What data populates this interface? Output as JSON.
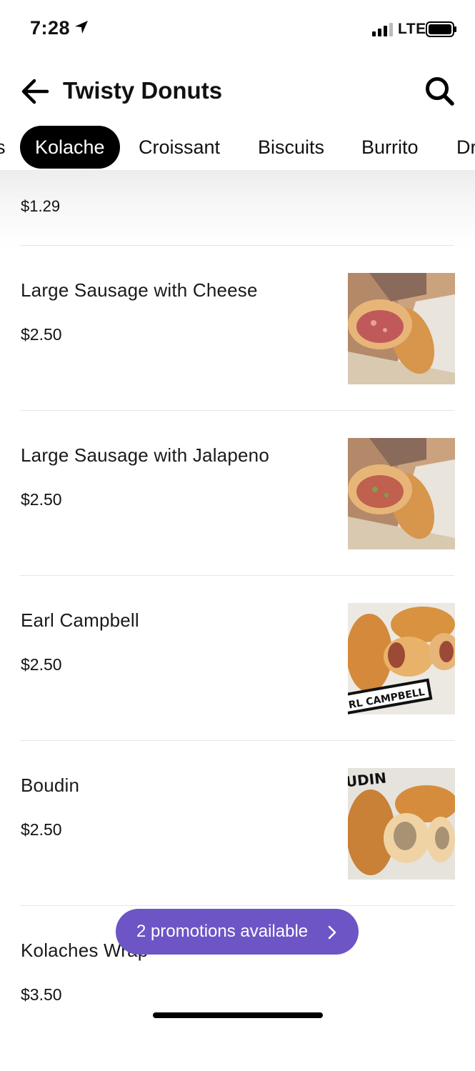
{
  "status_bar": {
    "time": "7:28",
    "network": "LTE",
    "icons": [
      "location-arrow-icon",
      "signal-icon",
      "battery-icon"
    ]
  },
  "header": {
    "title": "Twisty Donuts",
    "back_icon": "back-arrow-icon",
    "search_icon": "search-icon"
  },
  "tabs": [
    {
      "label": "s",
      "active": false
    },
    {
      "label": "Kolache",
      "active": true
    },
    {
      "label": "Croissant",
      "active": false
    },
    {
      "label": "Biscuits",
      "active": false
    },
    {
      "label": "Burrito",
      "active": false
    },
    {
      "label": "Dr",
      "active": false
    }
  ],
  "partial_item": {
    "price": "$1.29"
  },
  "items": [
    {
      "name": "Large Sausage with Cheese",
      "price": "$2.50",
      "photo": "sausage-cheese-kolache"
    },
    {
      "name": "Large Sausage with Jalapeno",
      "price": "$2.50",
      "photo": "sausage-jalapeno-kolache"
    },
    {
      "name": "Earl Campbell",
      "price": "$2.50",
      "photo": "earl-campbell-kolache",
      "photo_text": "RL CAMPBELL"
    },
    {
      "name": "Boudin",
      "price": "$2.50",
      "photo": "boudin-kolache",
      "photo_text": "UDIN"
    },
    {
      "name": "Kolaches Wrap",
      "price": "$3.50",
      "photo": null
    }
  ],
  "promo": {
    "label": "2 promotions available",
    "icon": "chevron-right-icon"
  },
  "colors": {
    "accent": "#6d55c6",
    "active_tab": "#000000",
    "divider": "#e6e6e6"
  }
}
